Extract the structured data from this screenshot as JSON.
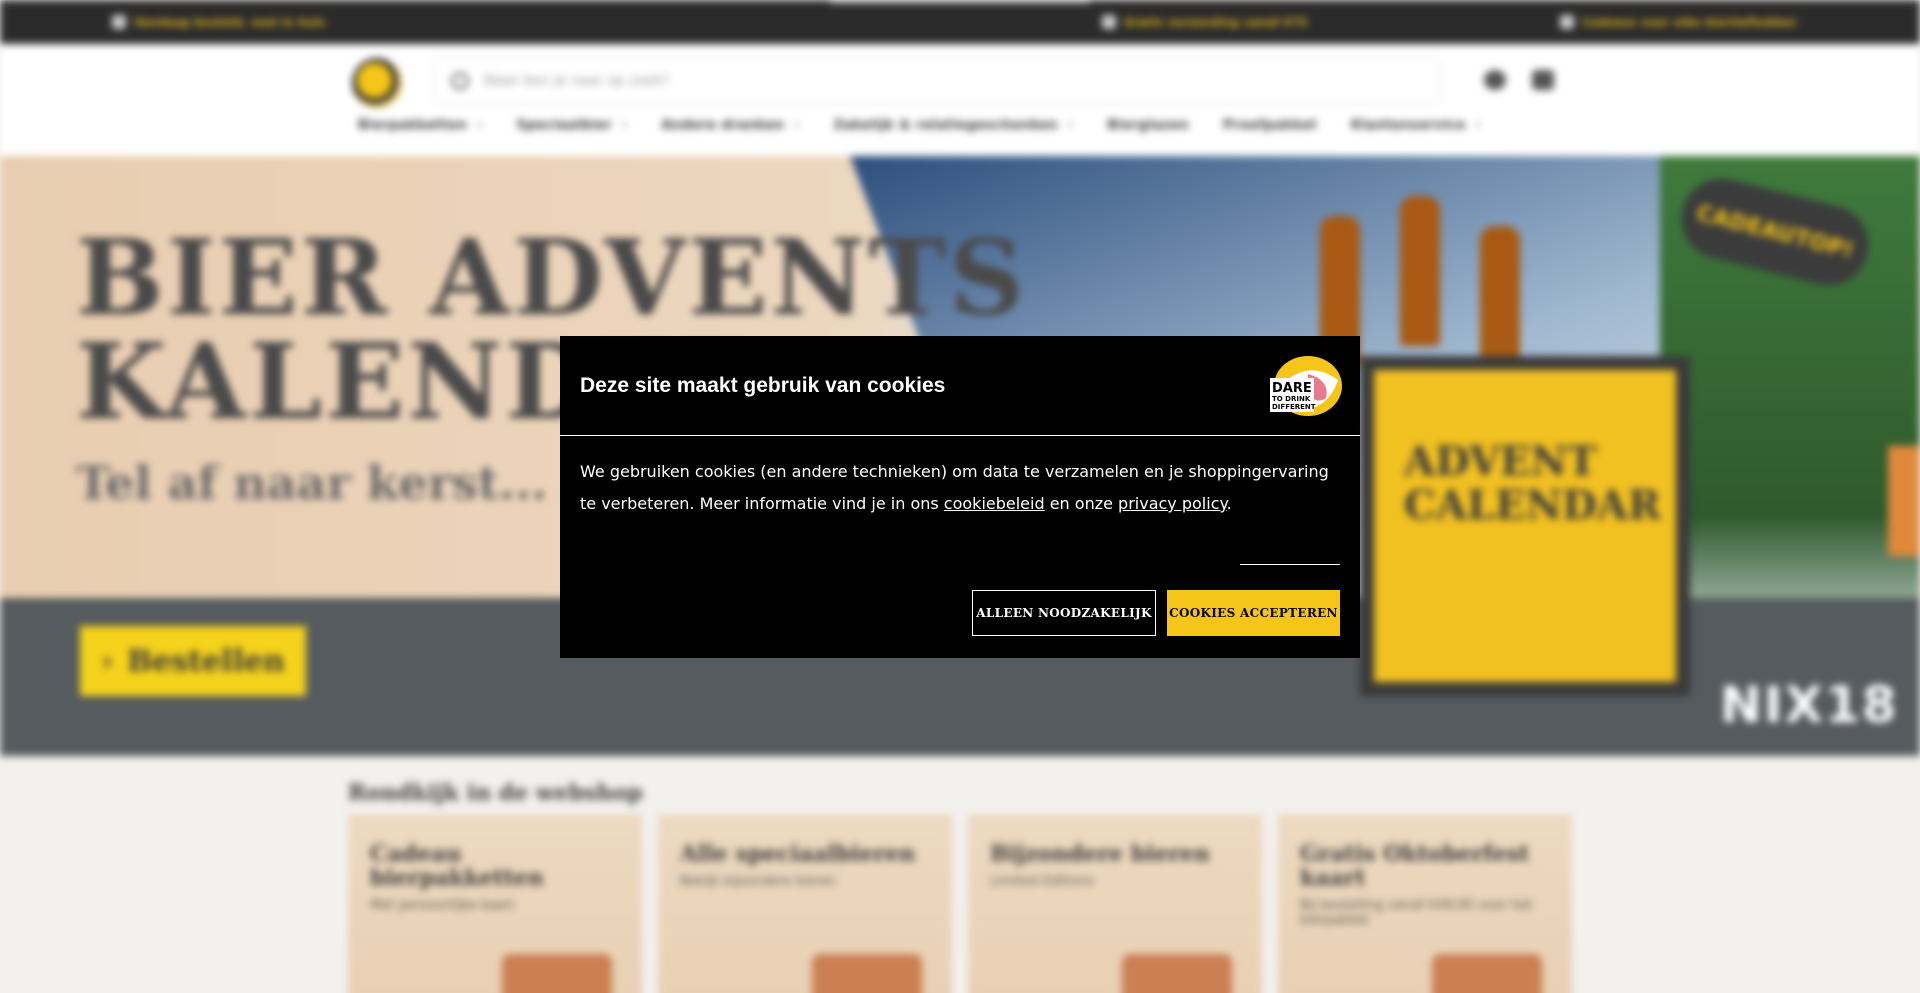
{
  "topbar": {
    "items": [
      {
        "icon": "truck-icon",
        "text": "Vandaag besteld, snel in huis"
      },
      {
        "icon": "tag-icon",
        "text": "Gratis verzending vanaf €75"
      },
      {
        "icon": "gift-icon",
        "text": "Cadeaus voor elke bierliefhebber"
      }
    ]
  },
  "header": {
    "search_placeholder": "Waar ben je naar op zoek?",
    "nav": [
      {
        "label": "Bierpakketten",
        "dropdown": true
      },
      {
        "label": "Speciaalbier",
        "dropdown": true
      },
      {
        "label": "Andere dranken",
        "dropdown": true
      },
      {
        "label": "Zakelijk & relatiegeschenken",
        "dropdown": true
      },
      {
        "label": "Bierglazen",
        "dropdown": false
      },
      {
        "label": "Proefpakket",
        "dropdown": false
      },
      {
        "label": "Klantenservice",
        "dropdown": true
      }
    ]
  },
  "hero": {
    "title_line1": "BIER ADVENTS",
    "title_line2": "KALENDER",
    "subtitle": "Tel af naar kerst...",
    "cta": "Bestellen",
    "box_title": "ADVENT CALENDAR",
    "badge": "CADEAUTOP!",
    "brandmark": "NIX18"
  },
  "section": {
    "title": "Rondkijk in de webshop",
    "cards": [
      {
        "title": "Cadeau bierpakketten",
        "subtitle": "Met persoonlijke kaart"
      },
      {
        "title": "Alle speciaalbieren",
        "subtitle": "Bekijk bijzondere bieren"
      },
      {
        "title": "Bijzondere bieren",
        "subtitle": "Limited Editions"
      },
      {
        "title": "Gratis Oktoberfest kaart",
        "subtitle": "Bij bestelling vanaf €49,95 voor het bierpakket"
      }
    ]
  },
  "cookie_dialog": {
    "title": "Deze site maakt gebruik van cookies",
    "logo_text": "DARE TO DRINK DIFFERENT",
    "body_before_link1": "We gebruiken cookies (en andere technieken) om data te verzamelen en je shoppingervaring te verbeteren. Meer informatie vind je in ons ",
    "link1": "cookiebeleid",
    "body_between": " en onze ",
    "link2": "privacy policy",
    "body_after": ".",
    "btn_necessary": "ALLEEN NOODZAKELIJK",
    "btn_accept": "COOKIES ACCEPTEREN"
  },
  "colors": {
    "accent_yellow": "#f5c51a",
    "dialog_bg": "#000000",
    "topbar_bg": "#2b2b2b"
  }
}
